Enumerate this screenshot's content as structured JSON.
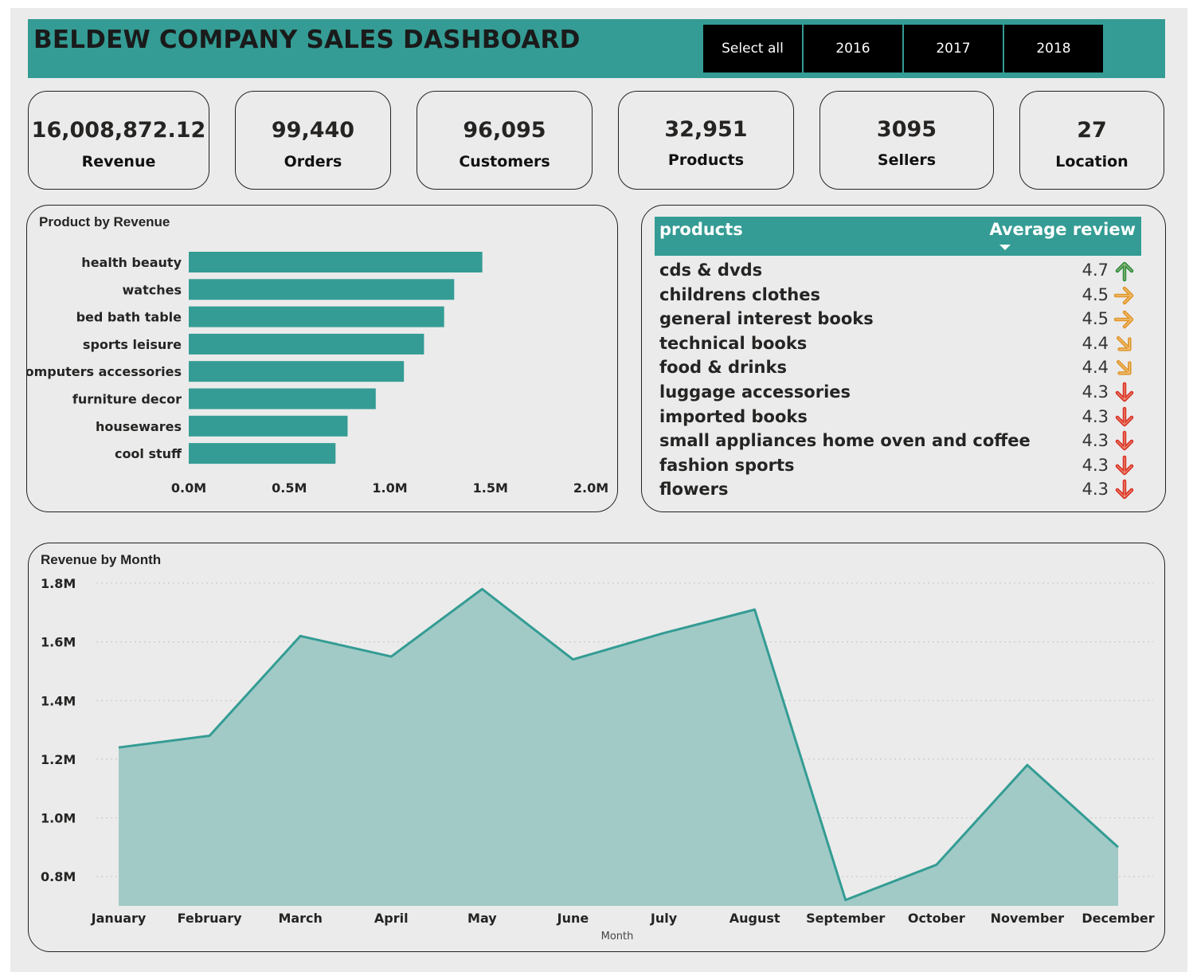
{
  "header": {
    "title": "BELDEW COMPANY SALES DASHBOARD",
    "year_slicer": [
      "Select all",
      "2016",
      "2017",
      "2018"
    ]
  },
  "kpis": [
    {
      "value": "16,008,872.12",
      "label": "Revenue"
    },
    {
      "value": "99,440",
      "label": "Orders"
    },
    {
      "value": "96,095",
      "label": "Customers"
    },
    {
      "value": "32,951",
      "label": "Products"
    },
    {
      "value": "3095",
      "label": "Sellers"
    },
    {
      "value": "27",
      "label": "Location"
    }
  ],
  "colors": {
    "accent": "#349c94",
    "area_fill": "#a1cac6",
    "arrow_up": "#2e8b3e",
    "arrow_side": "#e0952a",
    "arrow_down": "#d93025"
  },
  "reviews": {
    "columns": [
      "products",
      "Average review"
    ],
    "rows": [
      {
        "product": "cds & dvds",
        "avg": "4.7",
        "trend": "up"
      },
      {
        "product": "childrens clothes",
        "avg": "4.5",
        "trend": "right"
      },
      {
        "product": "general interest books",
        "avg": "4.5",
        "trend": "right"
      },
      {
        "product": "technical books",
        "avg": "4.4",
        "trend": "down-right"
      },
      {
        "product": "food & drinks",
        "avg": "4.4",
        "trend": "down-right"
      },
      {
        "product": "luggage accessories",
        "avg": "4.3",
        "trend": "down"
      },
      {
        "product": "imported books",
        "avg": "4.3",
        "trend": "down"
      },
      {
        "product": "small appliances home oven and coffee",
        "avg": "4.3",
        "trend": "down"
      },
      {
        "product": "fashion sports",
        "avg": "4.3",
        "trend": "down"
      },
      {
        "product": "flowers",
        "avg": "4.3",
        "trend": "down"
      }
    ]
  },
  "chart_data": [
    {
      "type": "bar",
      "orientation": "horizontal",
      "title": "Product by Revenue",
      "categories": [
        "health beauty",
        "watches",
        "bed bath table",
        "sports leisure",
        "computers accessories",
        "furniture decor",
        "housewares",
        "cool stuff"
      ],
      "values": [
        1.46,
        1.32,
        1.27,
        1.17,
        1.07,
        0.93,
        0.79,
        0.73
      ],
      "value_unit": "M",
      "xlim": [
        0,
        2.0
      ],
      "xticks": [
        "0.0M",
        "0.5M",
        "1.0M",
        "1.5M",
        "2.0M"
      ],
      "grid": false
    },
    {
      "type": "area",
      "title": "Revenue by Month",
      "xlabel": "Month",
      "categories": [
        "January",
        "February",
        "March",
        "April",
        "May",
        "June",
        "July",
        "August",
        "September",
        "October",
        "November",
        "December"
      ],
      "values": [
        1.24,
        1.28,
        1.62,
        1.55,
        1.78,
        1.54,
        1.63,
        1.71,
        0.72,
        0.84,
        1.18,
        0.9
      ],
      "value_unit": "M",
      "ylim": [
        0.7,
        1.8
      ],
      "yticks": [
        "1.8M",
        "1.6M",
        "1.4M",
        "1.2M",
        "1.0M",
        "0.8M"
      ],
      "ytick_values": [
        1.8,
        1.6,
        1.4,
        1.2,
        1.0,
        0.8
      ],
      "grid": true
    }
  ]
}
